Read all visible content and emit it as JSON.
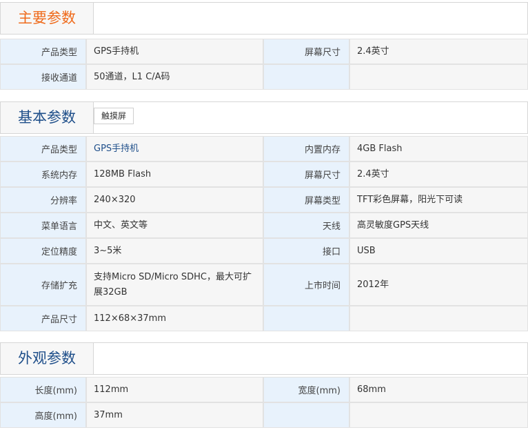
{
  "sections": [
    {
      "title": "主要参数",
      "rows": [
        [
          "产品类型",
          "GPS手持机",
          "屏幕尺寸",
          "2.4英寸"
        ],
        [
          "接收通道",
          "50通道，L1 C/A码",
          "",
          ""
        ]
      ]
    },
    {
      "title": "基本参数",
      "tag": "触摸屏",
      "rows": [
        [
          "产品类型",
          "GPS手持机",
          "内置内存",
          "4GB Flash"
        ],
        [
          "系统内存",
          "128MB Flash",
          "屏幕尺寸",
          "2.4英寸"
        ],
        [
          "分辨率",
          "240×320",
          "屏幕类型",
          "TFT彩色屏幕，阳光下可读"
        ],
        [
          "菜单语言",
          "中文、英文等",
          "天线",
          "高灵敏度GPS天线"
        ],
        [
          "定位精度",
          "3~5米",
          "接口",
          "USB"
        ],
        [
          "存储扩充",
          "支持Micro SD/Micro SDHC，最大可扩展32GB",
          "上市时间",
          "2012年"
        ],
        [
          "产品尺寸",
          "112×68×37mm",
          "",
          ""
        ]
      ]
    },
    {
      "title": "外观参数",
      "rows": [
        [
          "长度(mm)",
          "112mm",
          "宽度(mm)",
          "68mm"
        ],
        [
          "高度(mm)",
          "37mm",
          "",
          ""
        ]
      ]
    }
  ],
  "colors": {
    "title_main": "#ef6b1c",
    "title_other": "#1f4f8a",
    "label_bg": "#e8f2fc",
    "value_bg": "#f6f6f6",
    "link_blue": "#1f4f8a"
  }
}
